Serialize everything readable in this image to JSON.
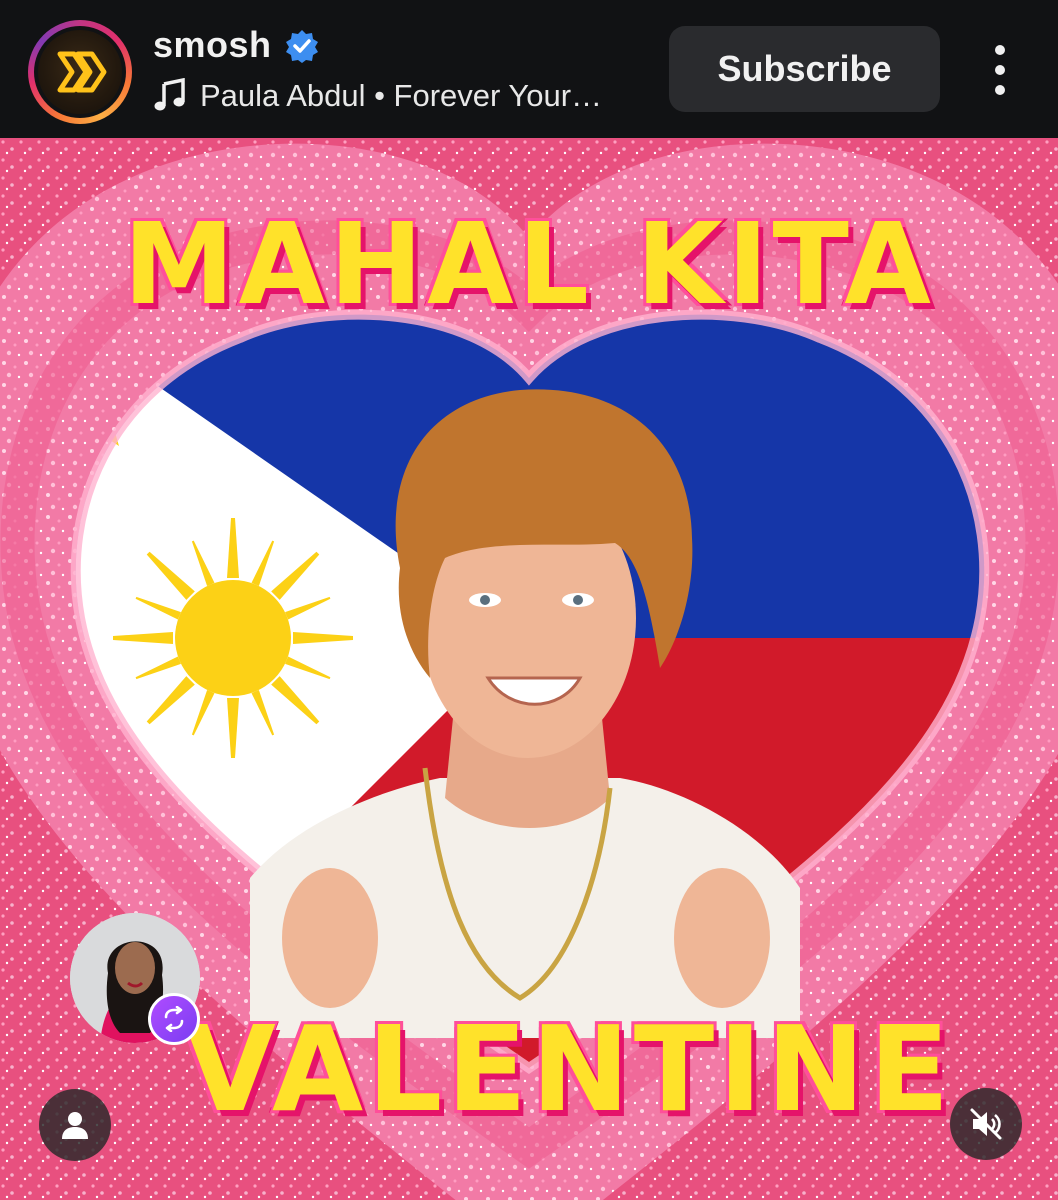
{
  "header": {
    "channel_name": "smosh",
    "verified_icon": "verified-badge-icon",
    "music_icon": "music-note-icon",
    "track": "Paula Abdul • Forever Your…",
    "subscribe_label": "Subscribe",
    "more_icon": "vertical-ellipsis-icon",
    "ring_colors": [
      "#c13584",
      "#f77737",
      "#fcaf45"
    ]
  },
  "video": {
    "title_top": "MAHAL KITA",
    "title_bottom": "VALENTINE",
    "colors": {
      "glitter_pink": "#f27aa6",
      "flag_blue": "#1536a8",
      "flag_red": "#d11a2a",
      "flag_white": "#ffffff",
      "sun_yellow": "#fcd116",
      "title_yellow": "#ffe22a",
      "title_outline": "#e5136a"
    },
    "collab_icon": "remix-icon",
    "profile_icon": "person-icon",
    "mute_icon": "volume-muted-icon"
  }
}
